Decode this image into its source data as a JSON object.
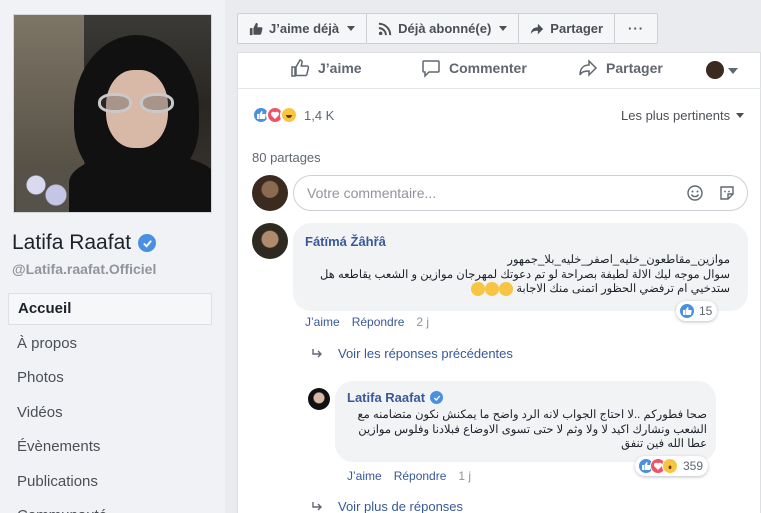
{
  "page": {
    "name": "Latifa Raafat",
    "handle": "@Latifa.raafat.Officiel"
  },
  "nav": [
    "Accueil",
    "À propos",
    "Photos",
    "Vidéos",
    "Évènements",
    "Publications",
    "Communauté"
  ],
  "actions": {
    "like": "J’aime déjà",
    "follow": "Déjà abonné(e)",
    "share": "Partager",
    "more": "···"
  },
  "social_bar": {
    "like": "J’aime",
    "comment": "Commenter",
    "share": "Partager"
  },
  "reactions": {
    "count": "1,4 K"
  },
  "sort_label": "Les plus pertinents",
  "shares": "80 partages",
  "composer": {
    "placeholder": "Votre commentaire..."
  },
  "comments": [
    {
      "author": "Fátïmá Žâhřâ",
      "lines": [
        "موازين_مقاطعون_خليه_اصفر_خليه_بلا_جمهور",
        "سوال موجه ليك الالة لطيفة بصراحة لو تم دعوتك لمهرجان موازين و الشعب يقاطعه هل",
        "ستدخيي ام ترفضي الحظور اتمنى منك الاجابة"
      ],
      "like": "J’aime",
      "reply": "Répondre",
      "time": "2 j",
      "reactions": "15"
    },
    {
      "author": "Latifa Raafat",
      "lines": [
        "صحا فطوركم ..لا احتاج الجواب لانه الرد واضح ما يمكنش نكون متضامنه مع",
        "الشعب ونشارك اكيد لا ولا وثم لا حتى تسوى الاوضاع فبلادنا وفلوس موازين",
        "عطا الله فين تنفق"
      ],
      "like": "J’aime",
      "reply": "Répondre",
      "time": "1 j",
      "reactions": "359"
    }
  ],
  "previous_replies": "Voir les réponses précédentes",
  "more_replies": "Voir plus de réponses",
  "colors": {
    "link": "#385898",
    "like_blue": "#4a90e2",
    "love_red": "#f25268",
    "haha_yellow": "#f7c542"
  }
}
